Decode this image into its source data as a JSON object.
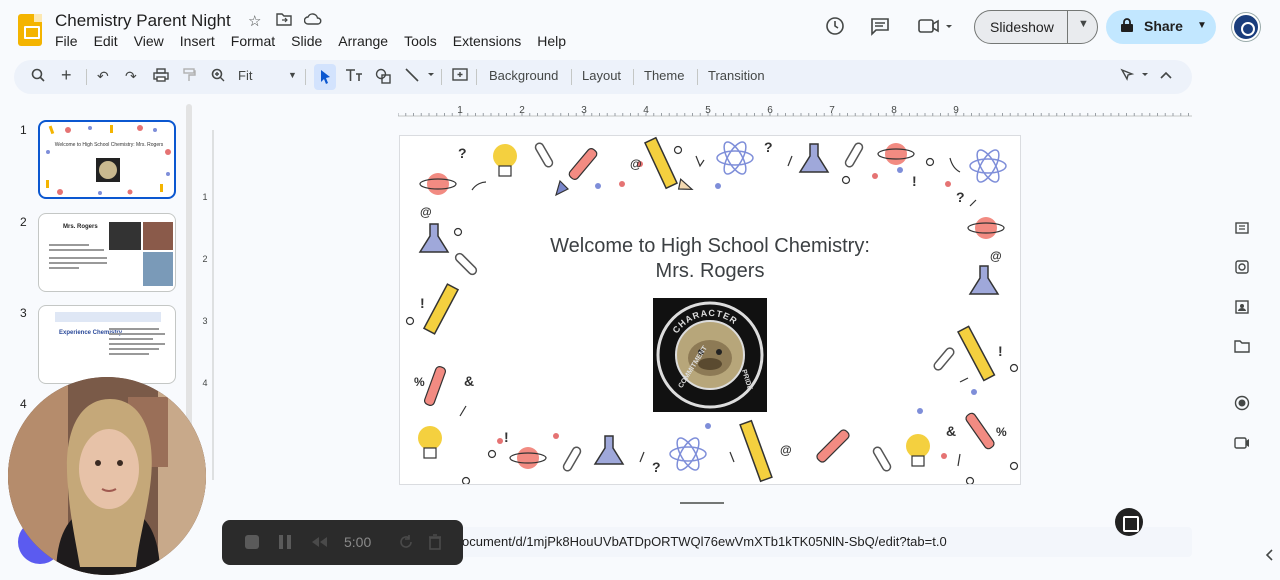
{
  "app": {
    "doc_title": "Chemistry Parent Night",
    "menu": [
      "File",
      "Edit",
      "View",
      "Insert",
      "Format",
      "Slide",
      "Arrange",
      "Tools",
      "Extensions",
      "Help"
    ],
    "slideshow_label": "Slideshow",
    "share_label": "Share",
    "accent": "#0b57d0",
    "share_bg": "#c2e7ff"
  },
  "toolbar": {
    "zoom": "Fit",
    "background_label": "Background",
    "layout_label": "Layout",
    "theme_label": "Theme",
    "transition_label": "Transition"
  },
  "ruler": {
    "marks": [
      "1",
      "2",
      "3",
      "4",
      "5",
      "6",
      "7",
      "8",
      "9"
    ],
    "vmarks": [
      "1",
      "2",
      "3",
      "4"
    ]
  },
  "filmstrip": {
    "slides": [
      {
        "number": "1",
        "title": "Welcome to High School Chemistry: Mrs. Rogers"
      },
      {
        "number": "2",
        "title": "Mrs. Rogers"
      },
      {
        "number": "3",
        "title": "Experience Chemistry"
      },
      {
        "number": "4"
      }
    ]
  },
  "slide": {
    "title_line1": "Welcome to High School Chemistry:",
    "title_line2": "Mrs. Rogers",
    "logo_text": "CHARACTER",
    "logo_text_left": "COMMITMENT",
    "logo_text_right": "PRIDE"
  },
  "address_bar": {
    "url": "ocument/d/1mjPk8HouUVbATDpORTWQl76ewVmXTb1kTK05NlN-SbQ/edit?tab=t.0"
  },
  "recorder": {
    "time": "5:00"
  }
}
